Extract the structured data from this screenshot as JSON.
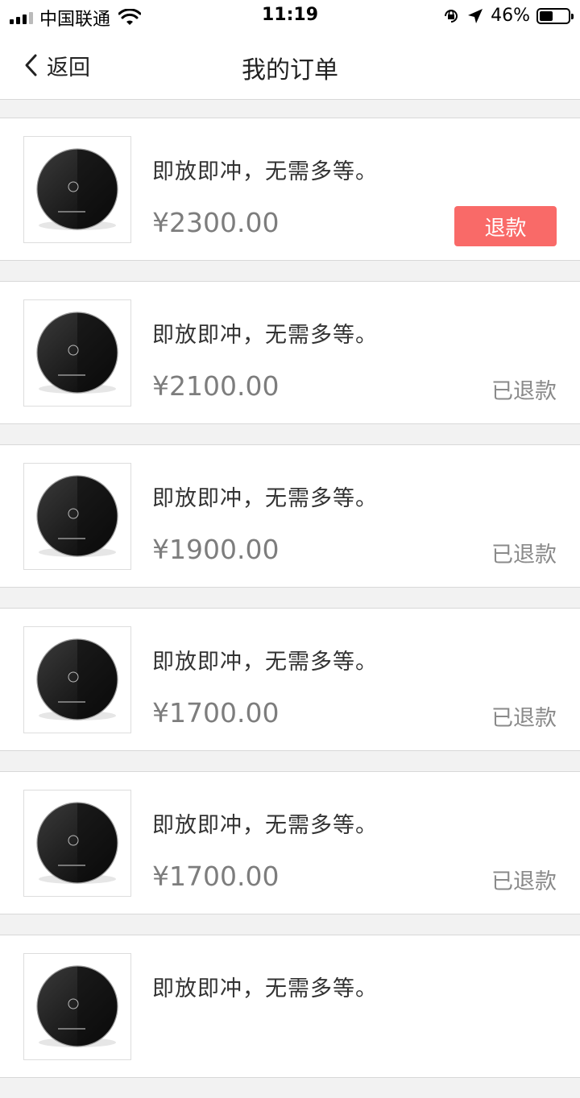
{
  "status_bar": {
    "carrier": "中国联通",
    "time": "11:19",
    "battery_percent": "46%",
    "battery_level": 0.46
  },
  "nav": {
    "back_label": "返回",
    "title": "我的订单"
  },
  "orders": [
    {
      "title": "即放即冲，无需多等。",
      "price": "¥2300.00",
      "action_label": "退款",
      "status": ""
    },
    {
      "title": "即放即冲，无需多等。",
      "price": "¥2100.00",
      "action_label": "",
      "status": "已退款"
    },
    {
      "title": "即放即冲，无需多等。",
      "price": "¥1900.00",
      "action_label": "",
      "status": "已退款"
    },
    {
      "title": "即放即冲，无需多等。",
      "price": "¥1700.00",
      "action_label": "",
      "status": "已退款"
    },
    {
      "title": "即放即冲，无需多等。",
      "price": "¥1700.00",
      "action_label": "",
      "status": "已退款"
    },
    {
      "title": "即放即冲，无需多等。",
      "price": "",
      "action_label": "",
      "status": ""
    }
  ],
  "colors": {
    "refund_button": "#f96a68",
    "background": "#f2f2f2"
  }
}
